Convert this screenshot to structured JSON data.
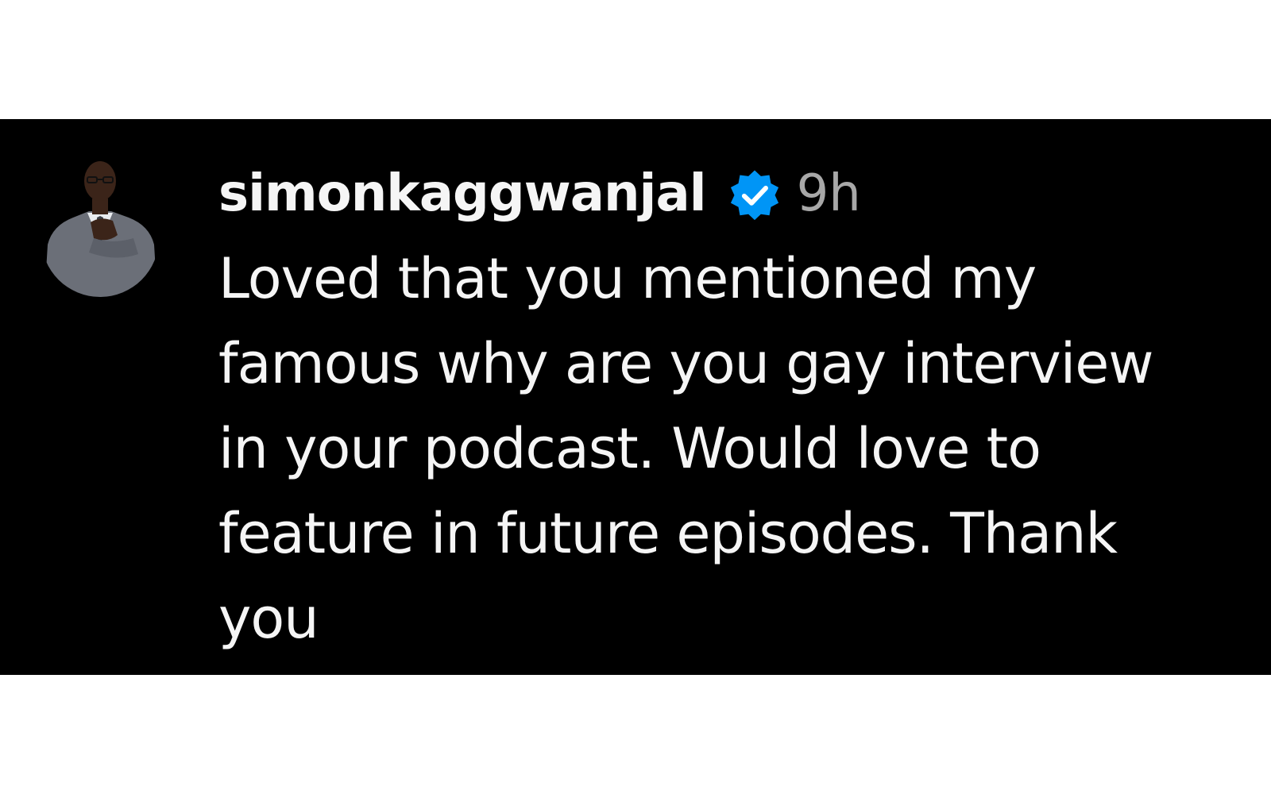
{
  "comment": {
    "username": "simonkaggwanjal",
    "verified": true,
    "verified_icon": "verified-badge-icon",
    "timestamp": "9h",
    "text_lines": [
      "Loved that you mentioned my",
      "famous why are you gay interview",
      "in your podcast. Would love to",
      "feature in future episodes. Thank",
      "you"
    ]
  },
  "colors": {
    "background": "#000000",
    "page_margin": "#ffffff",
    "text": "#f5f5f5",
    "timestamp": "#a8a8a8",
    "verified_badge": "#0095f6"
  }
}
